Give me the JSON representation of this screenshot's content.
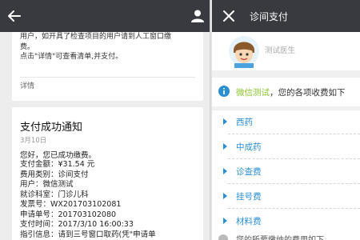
{
  "left": {
    "card1": {
      "lines": [
        "用户，如开具了检查项目的用户请到人工窗口缴",
        "费。",
        "点击\"详情\"可查看清单,并支付。"
      ],
      "detail_label": "详情"
    },
    "card2": {
      "title": "支付成功通知",
      "date": "3月10日",
      "greeting": "您好，您已成功缴费。",
      "lines": [
        "支付金额：¥31.54 元",
        "费用类别：诊间支付",
        "  用户：微信测试",
        "  就诊科室：门诊儿科",
        "  发票号：WX201703102081",
        "  申请单号：201703102080",
        "  支付时间：2017/3/10 16:00:33",
        "  指引信息：请到三号窗口取药(凭\"申请单"
      ]
    }
  },
  "right": {
    "title": "诊间支付",
    "doctor_name": "测试医生",
    "notice": {
      "highlight": "微信测试",
      "text": "，您的各项收费如下"
    },
    "fee_items": [
      "西药",
      "中成药",
      "诊查费",
      "挂号费",
      "材料费"
    ],
    "bottom_text": "您的所要缴纳的费用如下"
  },
  "colors": {
    "topbar": "#393a3f",
    "link": "#2a8fd3",
    "highlight": "#8cbf2c",
    "info": "#2a8fd3"
  }
}
